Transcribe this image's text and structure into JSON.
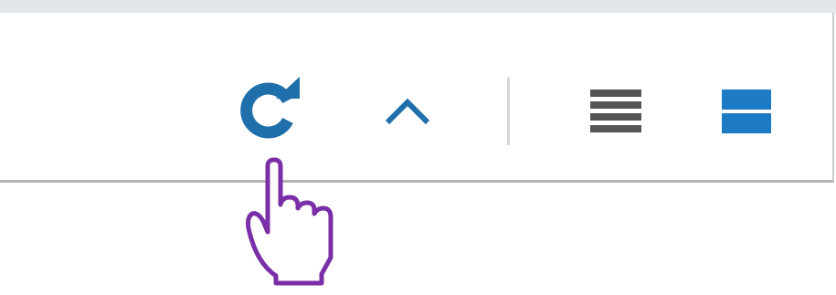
{
  "toolbar": {
    "buttons": [
      {
        "icon": "refresh-icon",
        "color": "#1f6fab"
      },
      {
        "icon": "chevron-up-icon",
        "color": "#1f6fab"
      },
      {
        "icon": "list-view-icon",
        "color": "#555555"
      },
      {
        "icon": "split-view-icon",
        "color": "#1c7bc4"
      }
    ]
  },
  "cursor": {
    "icon": "hand-pointer-icon",
    "color": "#7a2fa8"
  }
}
